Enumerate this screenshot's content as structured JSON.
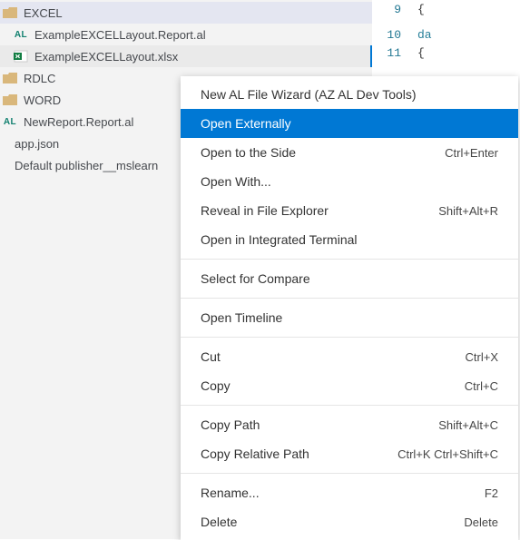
{
  "colors": {
    "accent": "#0078d4"
  },
  "editor": {
    "lines": [
      {
        "num": "9",
        "text": "{"
      },
      {
        "num": "10",
        "text": "da"
      },
      {
        "num": "11",
        "text": "{"
      }
    ]
  },
  "tree": {
    "excel": {
      "label": "EXCEL",
      "files": [
        {
          "label": "ExampleEXCELLayout.Report.al",
          "icon": "al"
        },
        {
          "label": "ExampleEXCELLayout.xlsx",
          "icon": "excel"
        }
      ]
    },
    "rdlc": {
      "label": "RDLC"
    },
    "word": {
      "label": "WORD"
    },
    "newreport": {
      "label": "NewReport.Report.al",
      "icon": "al"
    },
    "appjson": {
      "label": "app.json",
      "icon": "json"
    },
    "default": {
      "label": "Default publisher__mslearn"
    }
  },
  "menu": {
    "new_al_wizard": "New AL File Wizard (AZ AL Dev Tools)",
    "open_externally": "Open Externally",
    "open_side_label": "Open to the Side",
    "open_side_shortcut": "Ctrl+Enter",
    "open_with": "Open With...",
    "reveal_label": "Reveal in File Explorer",
    "reveal_shortcut": "Shift+Alt+R",
    "open_terminal": "Open in Integrated Terminal",
    "select_compare": "Select for Compare",
    "open_timeline": "Open Timeline",
    "cut_label": "Cut",
    "cut_shortcut": "Ctrl+X",
    "copy_label": "Copy",
    "copy_shortcut": "Ctrl+C",
    "copy_path_label": "Copy Path",
    "copy_path_shortcut": "Shift+Alt+C",
    "copy_rel_label": "Copy Relative Path",
    "copy_rel_shortcut": "Ctrl+K Ctrl+Shift+C",
    "rename_label": "Rename...",
    "rename_shortcut": "F2",
    "delete_label": "Delete",
    "delete_shortcut": "Delete"
  }
}
